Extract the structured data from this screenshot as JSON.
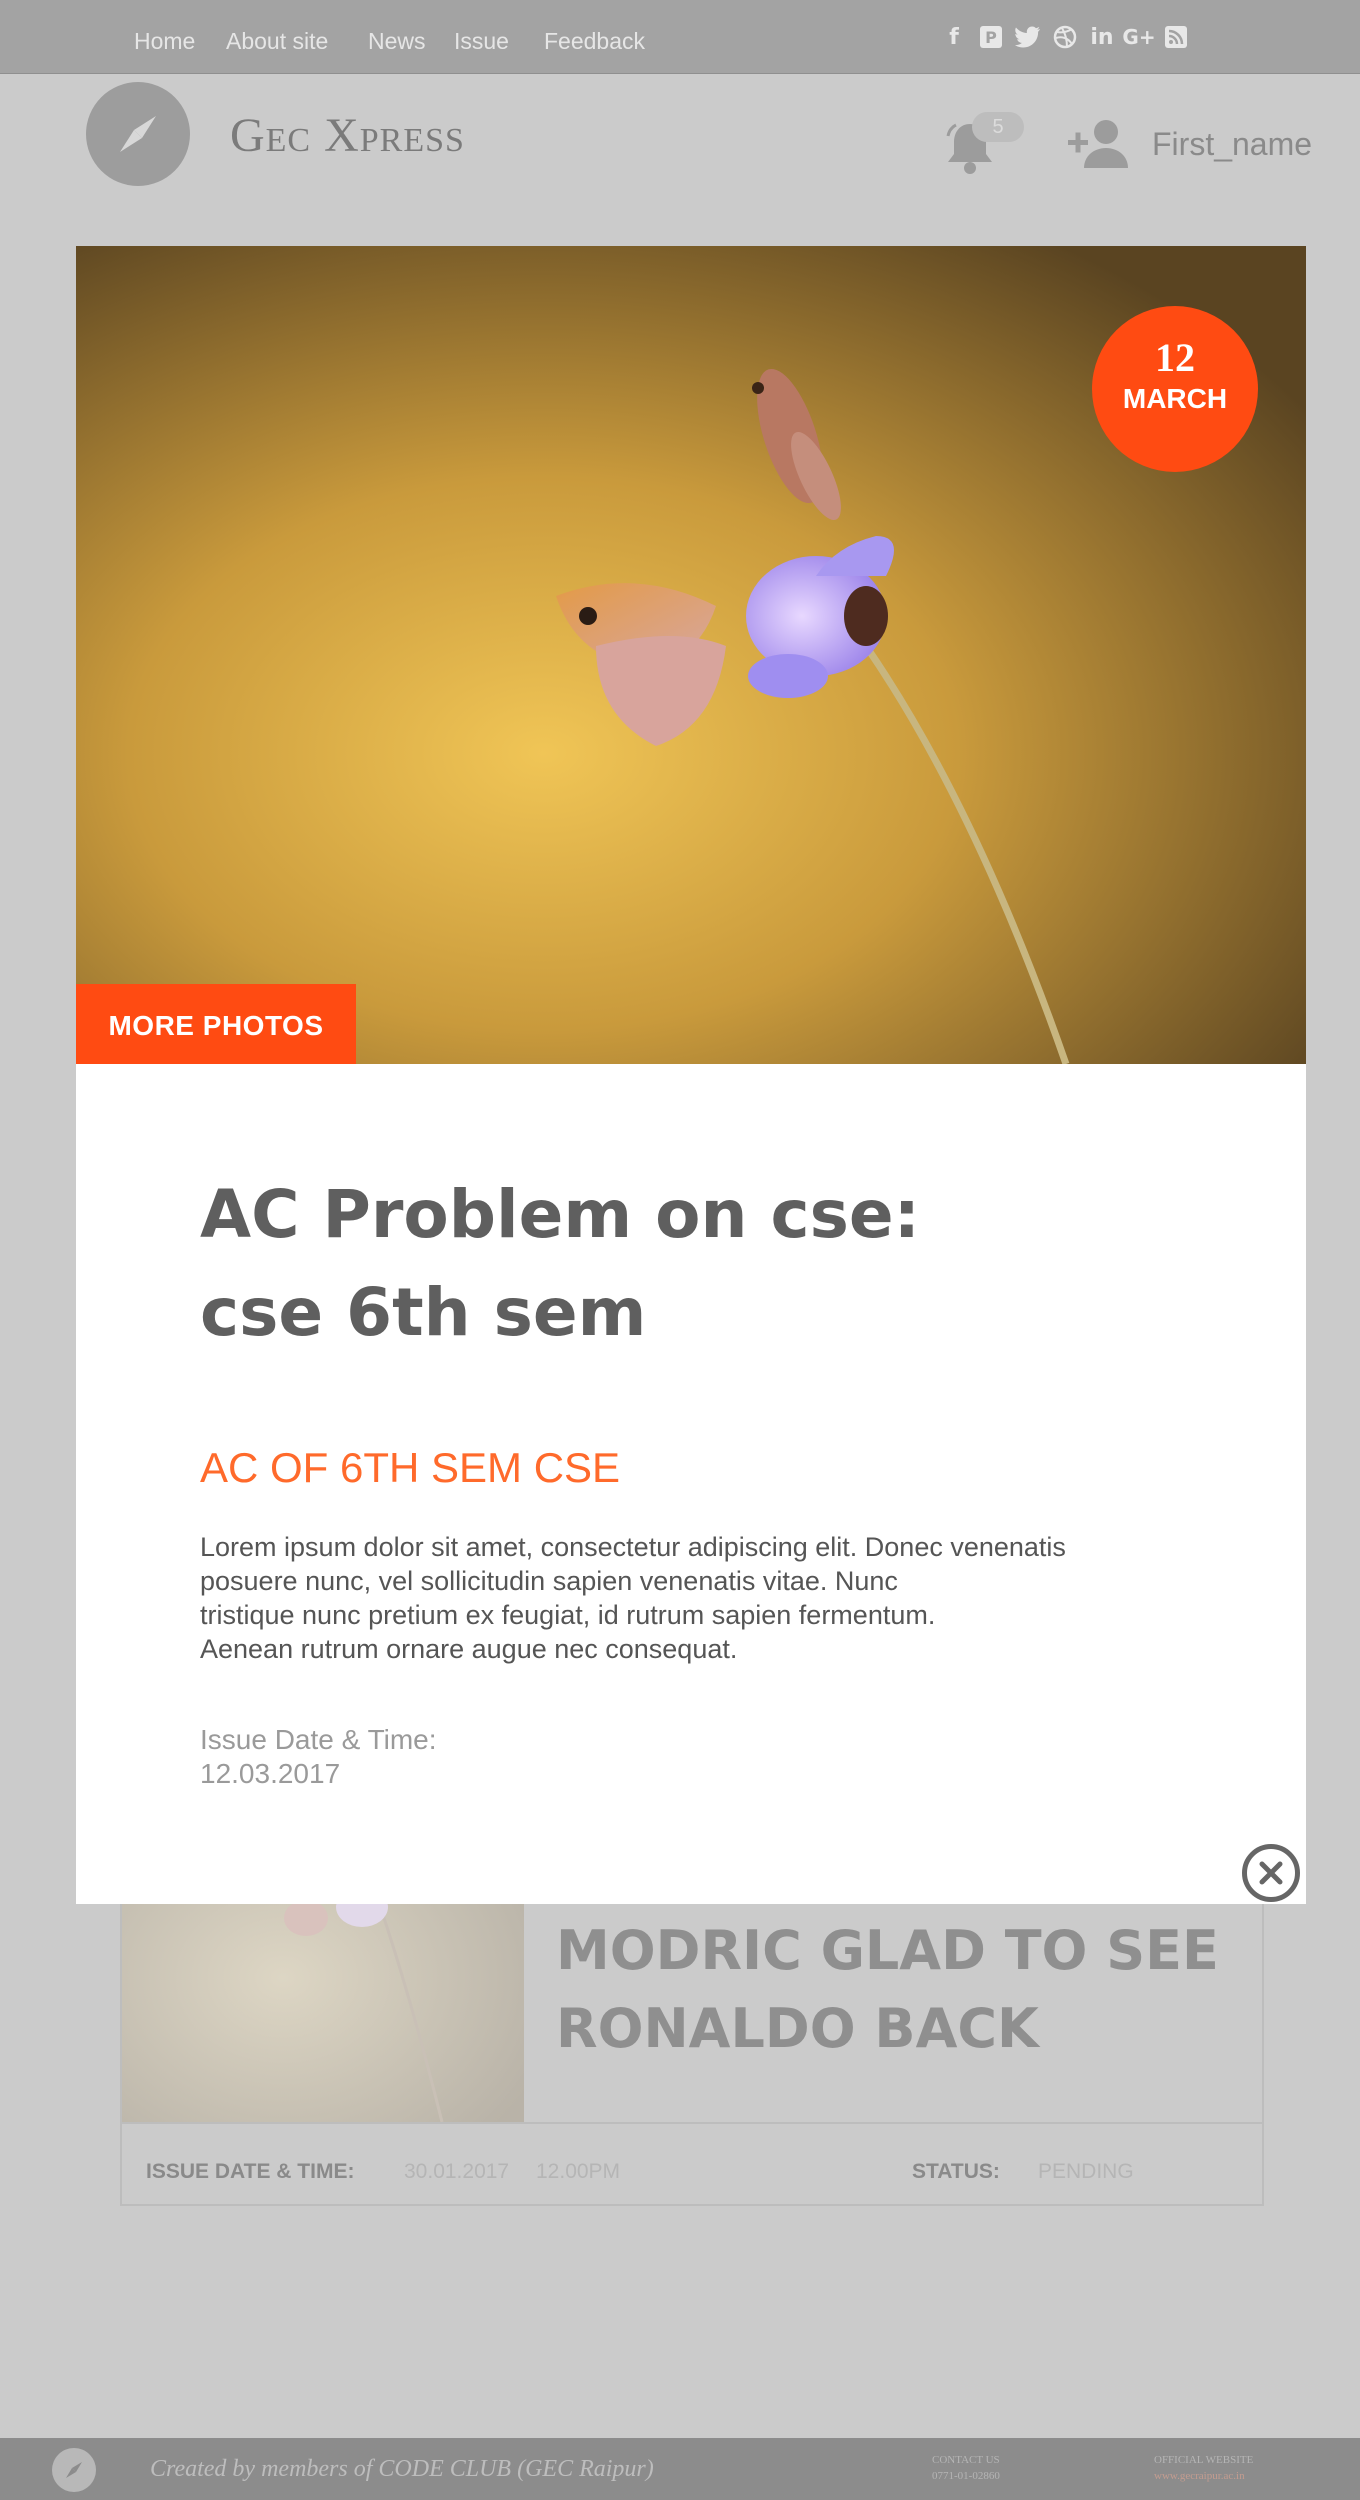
{
  "nav": {
    "items": [
      "Home",
      "About site",
      "News",
      "Issue",
      "Feedback"
    ]
  },
  "social_icons": [
    "facebook-icon",
    "pinterest-icon",
    "twitter-icon",
    "dribbble-icon",
    "linkedin-icon",
    "google-plus-icon",
    "rss-icon"
  ],
  "header": {
    "site_title": "Gec Xpress",
    "notification_count": "5",
    "username": "First_name"
  },
  "modal": {
    "date_day": "12",
    "date_month": "MARCH",
    "more_photos": "MORE PHOTOS",
    "title_line1": "AC Problem on cse:",
    "title_line2": "cse 6th sem",
    "subheading": "AC OF 6TH SEM CSE",
    "body": "Lorem ipsum dolor sit amet, consectetur adipiscing elit. Donec venenatis\nposuere nunc, vel sollicitudin sapien venenatis vitae. Nunc\ntristique nunc pretium ex feugiat, id rutrum sapien fermentum.\nAenean rutrum ornare augue nec consequat.",
    "issue_label": "Issue Date & Time:",
    "issue_value": "12.03.2017"
  },
  "background_card": {
    "title": "MODRIC GLAD TO SEE RONALDO BACK",
    "issue_label": "ISSUE DATE & TIME:",
    "issue_date": "30.01.2017",
    "issue_time": "12.00PM",
    "status_label": "STATUS:",
    "status_value": "PENDING"
  },
  "footer": {
    "credit": "Created by members of CODE CLUB (GEC Raipur)",
    "contact_label": "CONTACT US",
    "contact_value": "0771-01-02860",
    "website_label": "OFFICIAL WEBSITE",
    "website_value": "www.gecraipur.ac.in"
  },
  "colors": {
    "accent": "#ff4b12",
    "subheading": "#ff6a2b",
    "overlay_gray": "#cbcbcb",
    "topbar": "#a3a3a3"
  }
}
